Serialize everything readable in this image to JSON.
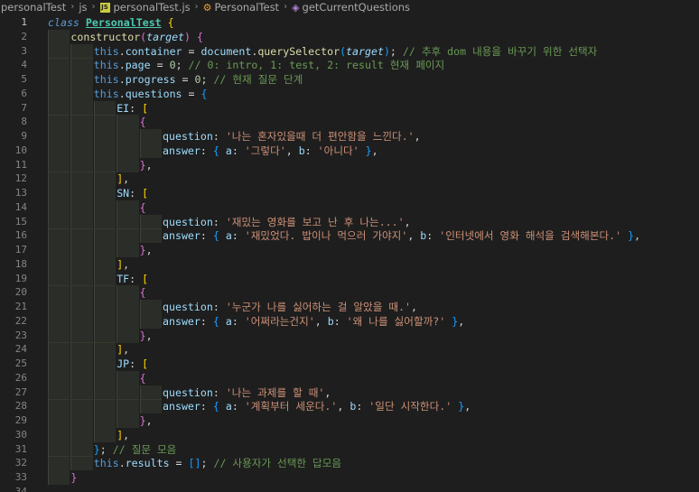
{
  "breadcrumb": {
    "items": [
      {
        "label": "personalTest",
        "icon": "none"
      },
      {
        "label": "js",
        "icon": "none"
      },
      {
        "label": "personalTest.js",
        "icon": "js-file-icon"
      },
      {
        "label": "PersonalTest",
        "icon": "class-icon"
      },
      {
        "label": "getCurrentQuestions",
        "icon": "method-icon"
      }
    ],
    "separator": "›",
    "js_badge": "JS"
  },
  "editor": {
    "active_line": 1,
    "lines": [
      {
        "n": "1",
        "indent": 0,
        "tokens": [
          [
            "kw",
            "class"
          ],
          [
            "punc",
            " "
          ],
          [
            "cls",
            "PersonalTest"
          ],
          [
            "punc",
            " "
          ],
          [
            "br1",
            "{"
          ]
        ]
      },
      {
        "n": "2",
        "indent": 1,
        "tokens": [
          [
            "fn",
            "constructor"
          ],
          [
            "br2",
            "("
          ],
          [
            "prm",
            "target"
          ],
          [
            "br2",
            ")"
          ],
          [
            "punc",
            " "
          ],
          [
            "br2",
            "{"
          ]
        ]
      },
      {
        "n": "3",
        "indent": 2,
        "tokens": [
          [
            "this",
            "this"
          ],
          [
            "punc",
            "."
          ],
          [
            "prop",
            "container"
          ],
          [
            "punc",
            " = "
          ],
          [
            "prop",
            "document"
          ],
          [
            "punc",
            "."
          ],
          [
            "fn",
            "querySelector"
          ],
          [
            "br3",
            "("
          ],
          [
            "prm",
            "target"
          ],
          [
            "br3",
            ")"
          ],
          [
            "punc",
            "; "
          ],
          [
            "com",
            "// 추후 dom 내용을 바꾸기 위한 선택자"
          ]
        ]
      },
      {
        "n": "4",
        "indent": 2,
        "tokens": [
          [
            "this",
            "this"
          ],
          [
            "punc",
            "."
          ],
          [
            "prop",
            "page"
          ],
          [
            "punc",
            " = "
          ],
          [
            "num",
            "0"
          ],
          [
            "punc",
            "; "
          ],
          [
            "com",
            "// 0: intro, 1: test, 2: result 현재 페이지"
          ]
        ]
      },
      {
        "n": "5",
        "indent": 2,
        "tokens": [
          [
            "this",
            "this"
          ],
          [
            "punc",
            "."
          ],
          [
            "prop",
            "progress"
          ],
          [
            "punc",
            " = "
          ],
          [
            "num",
            "0"
          ],
          [
            "punc",
            "; "
          ],
          [
            "com",
            "// 현재 질문 단계"
          ]
        ]
      },
      {
        "n": "6",
        "indent": 2,
        "tokens": [
          [
            "this",
            "this"
          ],
          [
            "punc",
            "."
          ],
          [
            "prop",
            "questions"
          ],
          [
            "punc",
            " = "
          ],
          [
            "br3",
            "{"
          ]
        ]
      },
      {
        "n": "7",
        "indent": 3,
        "tokens": [
          [
            "prop",
            "EI"
          ],
          [
            "punc",
            ": "
          ],
          [
            "br1",
            "["
          ]
        ]
      },
      {
        "n": "8",
        "indent": 4,
        "tokens": [
          [
            "br2",
            "{"
          ]
        ]
      },
      {
        "n": "9",
        "indent": 5,
        "tokens": [
          [
            "prop",
            "question"
          ],
          [
            "punc",
            ": "
          ],
          [
            "str",
            "'나는 혼자있을때 더 편안함을 느낀다.'"
          ],
          [
            "punc",
            ","
          ]
        ]
      },
      {
        "n": "10",
        "indent": 5,
        "tokens": [
          [
            "prop",
            "answer"
          ],
          [
            "punc",
            ": "
          ],
          [
            "br3",
            "{"
          ],
          [
            "punc",
            " "
          ],
          [
            "prop",
            "a"
          ],
          [
            "punc",
            ": "
          ],
          [
            "str",
            "'그렇다'"
          ],
          [
            "punc",
            ", "
          ],
          [
            "prop",
            "b"
          ],
          [
            "punc",
            ": "
          ],
          [
            "str",
            "'아니다'"
          ],
          [
            "punc",
            " "
          ],
          [
            "br3",
            "}"
          ],
          [
            "punc",
            ","
          ]
        ]
      },
      {
        "n": "11",
        "indent": 4,
        "tokens": [
          [
            "br2",
            "}"
          ],
          [
            "punc",
            ","
          ]
        ]
      },
      {
        "n": "12",
        "indent": 3,
        "tokens": [
          [
            "br1",
            "]"
          ],
          [
            "punc",
            ","
          ]
        ]
      },
      {
        "n": "13",
        "indent": 3,
        "tokens": [
          [
            "prop",
            "SN"
          ],
          [
            "punc",
            ": "
          ],
          [
            "br1",
            "["
          ]
        ]
      },
      {
        "n": "14",
        "indent": 4,
        "tokens": [
          [
            "br2",
            "{"
          ]
        ]
      },
      {
        "n": "15",
        "indent": 5,
        "tokens": [
          [
            "prop",
            "question"
          ],
          [
            "punc",
            ": "
          ],
          [
            "str",
            "'재밌는 영화를 보고 난 후 나는...'"
          ],
          [
            "punc",
            ","
          ]
        ]
      },
      {
        "n": "16",
        "indent": 5,
        "tokens": [
          [
            "prop",
            "answer"
          ],
          [
            "punc",
            ": "
          ],
          [
            "br3",
            "{"
          ],
          [
            "punc",
            " "
          ],
          [
            "prop",
            "a"
          ],
          [
            "punc",
            ": "
          ],
          [
            "str",
            "'재밌었다. 밥이나 먹으러 가야지'"
          ],
          [
            "punc",
            ", "
          ],
          [
            "prop",
            "b"
          ],
          [
            "punc",
            ": "
          ],
          [
            "str",
            "'인터넷에서 영화 해석을 검색해본다.'"
          ],
          [
            "punc",
            " "
          ],
          [
            "br3",
            "}"
          ],
          [
            "punc",
            ","
          ]
        ]
      },
      {
        "n": "17",
        "indent": 4,
        "tokens": [
          [
            "br2",
            "}"
          ],
          [
            "punc",
            ","
          ]
        ]
      },
      {
        "n": "18",
        "indent": 3,
        "tokens": [
          [
            "br1",
            "]"
          ],
          [
            "punc",
            ","
          ]
        ]
      },
      {
        "n": "19",
        "indent": 3,
        "tokens": [
          [
            "prop",
            "TF"
          ],
          [
            "punc",
            ": "
          ],
          [
            "br1",
            "["
          ]
        ]
      },
      {
        "n": "20",
        "indent": 4,
        "tokens": [
          [
            "br2",
            "{"
          ]
        ]
      },
      {
        "n": "21",
        "indent": 5,
        "tokens": [
          [
            "prop",
            "question"
          ],
          [
            "punc",
            ": "
          ],
          [
            "str",
            "'누군가 나를 싫어하는 걸 알았을 때.'"
          ],
          [
            "punc",
            ","
          ]
        ]
      },
      {
        "n": "22",
        "indent": 5,
        "tokens": [
          [
            "prop",
            "answer"
          ],
          [
            "punc",
            ": "
          ],
          [
            "br3",
            "{"
          ],
          [
            "punc",
            " "
          ],
          [
            "prop",
            "a"
          ],
          [
            "punc",
            ": "
          ],
          [
            "str",
            "'어쩌라는건지'"
          ],
          [
            "punc",
            ", "
          ],
          [
            "prop",
            "b"
          ],
          [
            "punc",
            ": "
          ],
          [
            "str",
            "'왜 나를 싫어할까?'"
          ],
          [
            "punc",
            " "
          ],
          [
            "br3",
            "}"
          ],
          [
            "punc",
            ","
          ]
        ]
      },
      {
        "n": "23",
        "indent": 4,
        "tokens": [
          [
            "br2",
            "}"
          ],
          [
            "punc",
            ","
          ]
        ]
      },
      {
        "n": "24",
        "indent": 3,
        "tokens": [
          [
            "br1",
            "]"
          ],
          [
            "punc",
            ","
          ]
        ]
      },
      {
        "n": "25",
        "indent": 3,
        "tokens": [
          [
            "prop",
            "JP"
          ],
          [
            "punc",
            ": "
          ],
          [
            "br1",
            "["
          ]
        ]
      },
      {
        "n": "26",
        "indent": 4,
        "tokens": [
          [
            "br2",
            "{"
          ]
        ]
      },
      {
        "n": "27",
        "indent": 5,
        "tokens": [
          [
            "prop",
            "question"
          ],
          [
            "punc",
            ": "
          ],
          [
            "str",
            "'나는 과제를 할 때'"
          ],
          [
            "punc",
            ","
          ]
        ]
      },
      {
        "n": "28",
        "indent": 5,
        "tokens": [
          [
            "prop",
            "answer"
          ],
          [
            "punc",
            ": "
          ],
          [
            "br3",
            "{"
          ],
          [
            "punc",
            " "
          ],
          [
            "prop",
            "a"
          ],
          [
            "punc",
            ": "
          ],
          [
            "str",
            "'계획부터 세운다.'"
          ],
          [
            "punc",
            ", "
          ],
          [
            "prop",
            "b"
          ],
          [
            "punc",
            ": "
          ],
          [
            "str",
            "'일단 시작한다.'"
          ],
          [
            "punc",
            " "
          ],
          [
            "br3",
            "}"
          ],
          [
            "punc",
            ","
          ]
        ]
      },
      {
        "n": "29",
        "indent": 4,
        "tokens": [
          [
            "br2",
            "}"
          ],
          [
            "punc",
            ","
          ]
        ]
      },
      {
        "n": "30",
        "indent": 3,
        "tokens": [
          [
            "br1",
            "]"
          ],
          [
            "punc",
            ","
          ]
        ]
      },
      {
        "n": "31",
        "indent": 2,
        "tokens": [
          [
            "br3",
            "}"
          ],
          [
            "punc",
            "; "
          ],
          [
            "com",
            "// 질문 모음"
          ]
        ]
      },
      {
        "n": "32",
        "indent": 2,
        "tokens": [
          [
            "this",
            "this"
          ],
          [
            "punc",
            "."
          ],
          [
            "prop",
            "results"
          ],
          [
            "punc",
            " = "
          ],
          [
            "br3",
            "[]"
          ],
          [
            "punc",
            "; "
          ],
          [
            "com",
            "// 사용자가 선택한 답모음"
          ]
        ]
      },
      {
        "n": "33",
        "indent": 1,
        "tokens": [
          [
            "br2",
            "}"
          ]
        ]
      },
      {
        "n": "34",
        "indent": 0,
        "tokens": []
      }
    ]
  }
}
